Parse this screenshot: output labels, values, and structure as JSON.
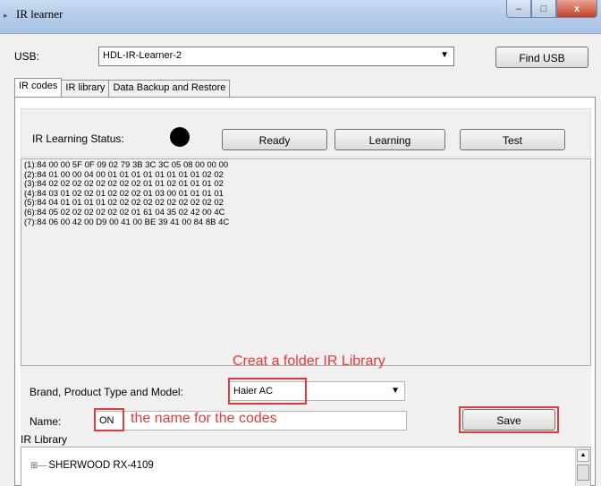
{
  "window": {
    "title": "IR learner",
    "minimize_label": "‒",
    "maximize_label": "□",
    "close_label": "x"
  },
  "usb": {
    "label": "USB:",
    "selected": "HDL-IR-Learner-2",
    "find_button": "Find USB"
  },
  "tabs": [
    {
      "label": "IR codes",
      "active": true
    },
    {
      "label": "IR library",
      "active": false
    },
    {
      "label": "Data Backup and Restore",
      "active": false
    }
  ],
  "learning": {
    "status_label": "IR Learning Status:",
    "ready_button": "Ready",
    "learning_button": "Learning",
    "test_button": "Test"
  },
  "codes": [
    "(1):84 00 00 5F 0F 09 02 79 3B 3C 3C 05 08 00 00 00",
    "(2):84 01 00 00 04 00 01 01 01 01 01 01 01 01 02 02",
    "(3):84 02 02 02 02 02 02 02 02 01 01 02 01 01 01 02",
    "(4):84 03 01 02 02 01 02 02 02 01 03 00 01 01 01 01",
    "(5):84 04 01 01 01 01 02 02 02 02 02 02 02 02 02 02",
    "(6):84 05 02 02 02 02 02 02 01 61 04 35 02 42 00 4C",
    "(7):84 06 00 42 00 D9 00 41 00 BE 39 41 00 84 8B 4C"
  ],
  "form": {
    "annotation_folder": "Creat a folder IR Library",
    "brand_label": "Brand, Product Type and Model:",
    "brand_value": "Haier AC",
    "name_label": "Name:",
    "name_value": "ON",
    "annotation_name": "the name for the codes",
    "save_button": "Save"
  },
  "library": {
    "label": "IR Library",
    "items": [
      "SHERWOOD RX-4109"
    ]
  },
  "colors": {
    "annotation": "#e83838",
    "titlebar": "#b5cde9"
  }
}
